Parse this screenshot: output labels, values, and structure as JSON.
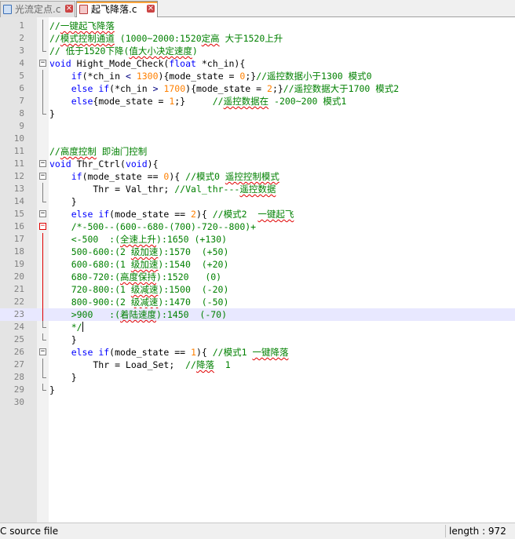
{
  "tabs": [
    {
      "label": "光流定点.c",
      "active": false
    },
    {
      "label": "起飞降落.c",
      "active": true
    }
  ],
  "editor": {
    "current_line": 24,
    "lines": [
      {
        "n": "1",
        "fold": "vert",
        "segs": [
          {
            "c": "cm",
            "t": "//"
          },
          {
            "c": "cm sq",
            "t": "一键起飞降落"
          }
        ]
      },
      {
        "n": "2",
        "fold": "vert",
        "segs": [
          {
            "c": "cm",
            "t": "//"
          },
          {
            "c": "cm sq",
            "t": "模式控制通道"
          },
          {
            "c": "cm",
            "t": " (1000~2000:1520"
          },
          {
            "c": "cm sq",
            "t": "定高"
          },
          {
            "c": "cm",
            "t": " 大于1520上升"
          }
        ]
      },
      {
        "n": "3",
        "fold": "end",
        "segs": [
          {
            "c": "cm",
            "t": "// 低于1520下降("
          },
          {
            "c": "cm sq",
            "t": "值大小决定速度"
          },
          {
            "c": "cm",
            "t": ")"
          }
        ]
      },
      {
        "n": "4",
        "fold": "box",
        "segs": [
          {
            "c": "kw",
            "t": "void"
          },
          {
            "c": "",
            "t": " Hight_Mode_Check("
          },
          {
            "c": "kw",
            "t": "float"
          },
          {
            "c": "",
            "t": " *ch_in){"
          }
        ]
      },
      {
        "n": "5",
        "fold": "vert",
        "segs": [
          {
            "c": "",
            "t": "    "
          },
          {
            "c": "kw",
            "t": "if"
          },
          {
            "c": "",
            "t": "(*ch_in "
          },
          {
            "c": "op",
            "t": "<"
          },
          {
            "c": "",
            "t": " "
          },
          {
            "c": "num",
            "t": "1300"
          },
          {
            "c": "",
            "t": "){mode_state = "
          },
          {
            "c": "num",
            "t": "0"
          },
          {
            "c": "",
            "t": ";}"
          },
          {
            "c": "cm",
            "t": "//遥控数据小于1300 模式0"
          }
        ]
      },
      {
        "n": "6",
        "fold": "vert",
        "segs": [
          {
            "c": "",
            "t": "    "
          },
          {
            "c": "kw",
            "t": "else if"
          },
          {
            "c": "",
            "t": "(*ch_in "
          },
          {
            "c": "op",
            "t": ">"
          },
          {
            "c": "",
            "t": " "
          },
          {
            "c": "num",
            "t": "1700"
          },
          {
            "c": "",
            "t": "){mode_state = "
          },
          {
            "c": "num",
            "t": "2"
          },
          {
            "c": "",
            "t": ";}"
          },
          {
            "c": "cm",
            "t": "//遥控数据大于1700 模式2"
          }
        ]
      },
      {
        "n": "7",
        "fold": "vert",
        "segs": [
          {
            "c": "",
            "t": "    "
          },
          {
            "c": "kw",
            "t": "else"
          },
          {
            "c": "",
            "t": "{mode_state = "
          },
          {
            "c": "num",
            "t": "1"
          },
          {
            "c": "",
            "t": ";}     "
          },
          {
            "c": "cm",
            "t": "//"
          },
          {
            "c": "cm sq",
            "t": "遥控数据在"
          },
          {
            "c": "cm",
            "t": " -200~200 模式1"
          }
        ]
      },
      {
        "n": "8",
        "fold": "end",
        "segs": [
          {
            "c": "",
            "t": "}"
          }
        ]
      },
      {
        "n": "9",
        "fold": "",
        "segs": []
      },
      {
        "n": "10",
        "fold": "",
        "segs": []
      },
      {
        "n": "11",
        "fold": "",
        "segs": [
          {
            "c": "cm",
            "t": "//"
          },
          {
            "c": "cm sq",
            "t": "高度控制"
          },
          {
            "c": "cm",
            "t": " 即油门控制"
          }
        ]
      },
      {
        "n": "11",
        "fold": "box",
        "segs": [
          {
            "c": "kw",
            "t": "void"
          },
          {
            "c": "",
            "t": " Thr_Ctrl("
          },
          {
            "c": "kw",
            "t": "void"
          },
          {
            "c": "",
            "t": "){"
          }
        ]
      },
      {
        "n": "12",
        "fold": "box",
        "segs": [
          {
            "c": "",
            "t": "    "
          },
          {
            "c": "kw",
            "t": "if"
          },
          {
            "c": "",
            "t": "(mode_state == "
          },
          {
            "c": "num",
            "t": "0"
          },
          {
            "c": "",
            "t": "){ "
          },
          {
            "c": "cm",
            "t": "//模式0 "
          },
          {
            "c": "cm sq",
            "t": "遥控控制模式"
          }
        ]
      },
      {
        "n": "13",
        "fold": "vert",
        "segs": [
          {
            "c": "",
            "t": "        Thr = Val_thr; "
          },
          {
            "c": "cm",
            "t": "//Val_thr---"
          },
          {
            "c": "cm sq",
            "t": "遥控数据"
          }
        ]
      },
      {
        "n": "14",
        "fold": "end",
        "segs": [
          {
            "c": "",
            "t": "    }"
          }
        ]
      },
      {
        "n": "15",
        "fold": "box",
        "segs": [
          {
            "c": "",
            "t": "    "
          },
          {
            "c": "kw",
            "t": "else if"
          },
          {
            "c": "",
            "t": "(mode_state == "
          },
          {
            "c": "num",
            "t": "2"
          },
          {
            "c": "",
            "t": "){ "
          },
          {
            "c": "cm",
            "t": "//模式2  "
          },
          {
            "c": "cm sq",
            "t": "一键起飞"
          }
        ]
      },
      {
        "n": "16",
        "fold": "boxred",
        "segs": [
          {
            "c": "cm",
            "t": "    /*-500--(600--680-(700)-720--800)+"
          }
        ]
      },
      {
        "n": "17",
        "fold": "vertred",
        "segs": [
          {
            "c": "cm",
            "t": "    <-500  :("
          },
          {
            "c": "cm sq",
            "t": "全速上升"
          },
          {
            "c": "cm",
            "t": "):1650 (+130)"
          }
        ]
      },
      {
        "n": "18",
        "fold": "vertred",
        "segs": [
          {
            "c": "cm",
            "t": "    500-600:(2 "
          },
          {
            "c": "cm sq",
            "t": "级加速"
          },
          {
            "c": "cm",
            "t": "):1570  (+50)"
          }
        ]
      },
      {
        "n": "19",
        "fold": "vertred",
        "segs": [
          {
            "c": "cm",
            "t": "    600-680:(1 "
          },
          {
            "c": "cm sq",
            "t": "级加速"
          },
          {
            "c": "cm",
            "t": "):1540  (+20)"
          }
        ]
      },
      {
        "n": "20",
        "fold": "vertred",
        "segs": [
          {
            "c": "cm",
            "t": "    680-720:("
          },
          {
            "c": "cm sq",
            "t": "高度保持"
          },
          {
            "c": "cm",
            "t": "):1520   (0)"
          }
        ]
      },
      {
        "n": "21",
        "fold": "vertred",
        "segs": [
          {
            "c": "cm",
            "t": "    720-800:(1 "
          },
          {
            "c": "cm sq",
            "t": "级减速"
          },
          {
            "c": "cm",
            "t": "):1500  (-20)"
          }
        ]
      },
      {
        "n": "22",
        "fold": "vertred",
        "segs": [
          {
            "c": "cm",
            "t": "    800-900:(2 "
          },
          {
            "c": "cm sq",
            "t": "级减速"
          },
          {
            "c": "cm",
            "t": "):1470  (-50)"
          }
        ]
      },
      {
        "n": "23",
        "fold": "vertred",
        "segs": [
          {
            "c": "cm",
            "t": "    >900   :("
          },
          {
            "c": "cm sq",
            "t": "着陆速度"
          },
          {
            "c": "cm",
            "t": "):1450  (-70)"
          }
        ]
      },
      {
        "n": "24",
        "fold": "end",
        "caret": true,
        "segs": [
          {
            "c": "cm",
            "t": "    */"
          }
        ]
      },
      {
        "n": "25",
        "fold": "end",
        "segs": [
          {
            "c": "",
            "t": "    }"
          }
        ]
      },
      {
        "n": "26",
        "fold": "box",
        "segs": [
          {
            "c": "",
            "t": "    "
          },
          {
            "c": "kw",
            "t": "else if"
          },
          {
            "c": "",
            "t": "(mode_state == "
          },
          {
            "c": "num",
            "t": "1"
          },
          {
            "c": "",
            "t": "){ "
          },
          {
            "c": "cm",
            "t": "//模式1 "
          },
          {
            "c": "cm sq",
            "t": "一键降落"
          }
        ]
      },
      {
        "n": "27",
        "fold": "vert",
        "segs": [
          {
            "c": "",
            "t": "        Thr = Load_Set;  "
          },
          {
            "c": "cm",
            "t": "//"
          },
          {
            "c": "cm sq",
            "t": "降落"
          },
          {
            "c": "cm",
            "t": "  1"
          }
        ]
      },
      {
        "n": "28",
        "fold": "end",
        "segs": [
          {
            "c": "",
            "t": "    }"
          }
        ]
      },
      {
        "n": "29",
        "fold": "end",
        "segs": [
          {
            "c": "",
            "t": "}"
          }
        ]
      },
      {
        "n": "30",
        "fold": "",
        "segs": []
      }
    ]
  },
  "status": {
    "file_type": "C source file",
    "length": "length : 972"
  }
}
